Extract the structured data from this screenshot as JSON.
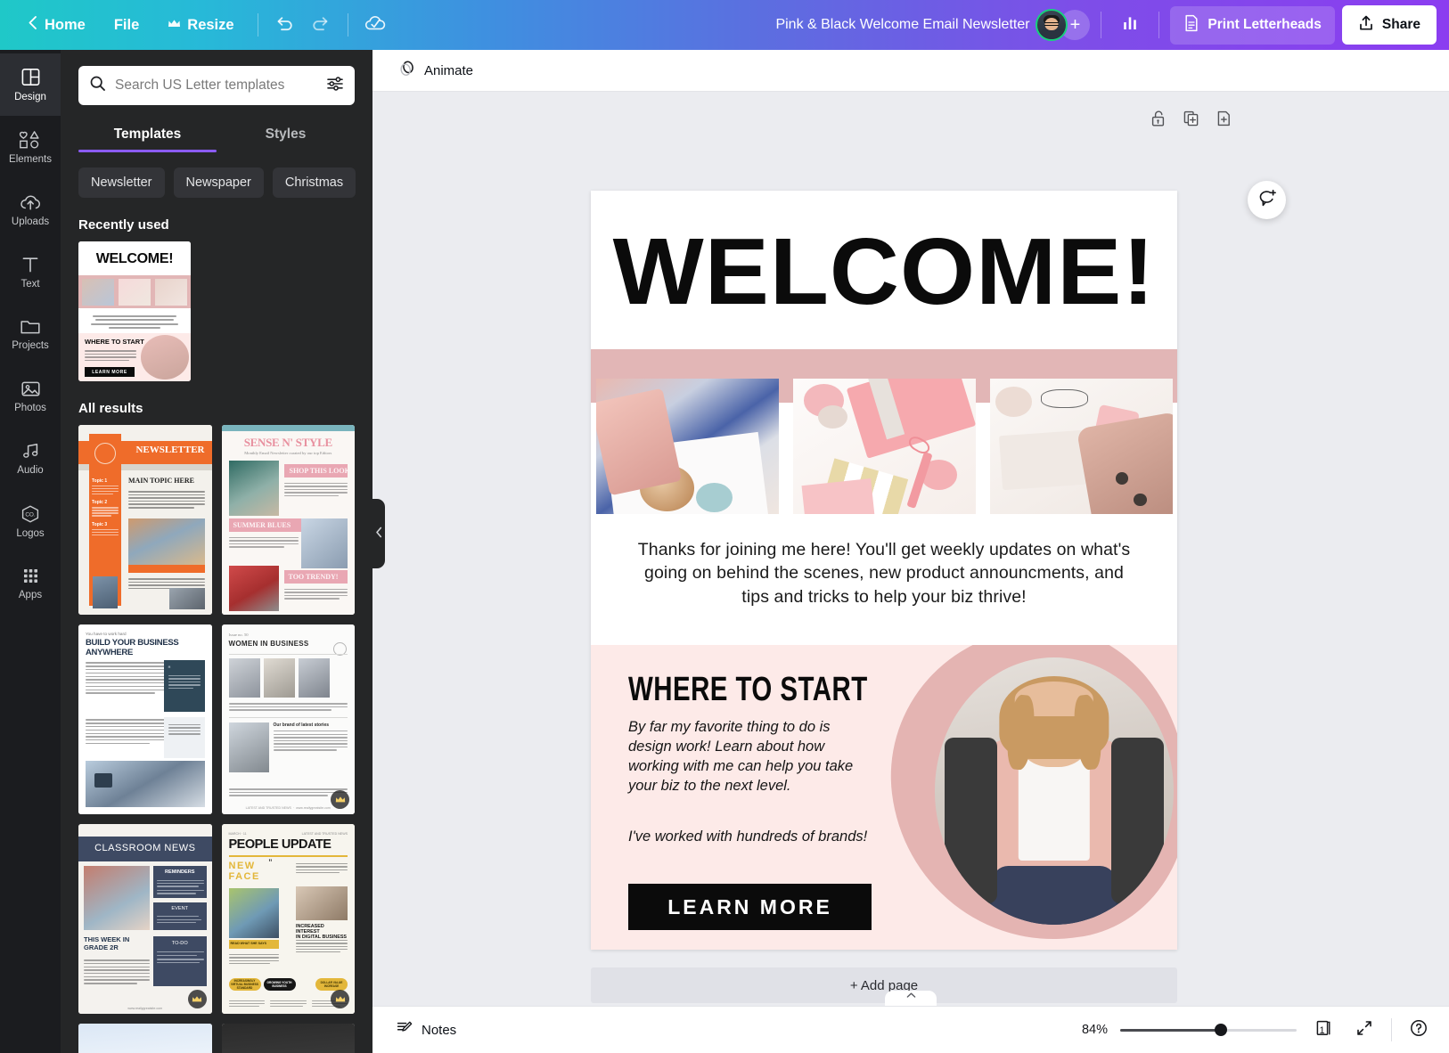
{
  "topbar": {
    "back_icon": "chevron-left-icon",
    "home_label": "Home",
    "file_label": "File",
    "resize_label": "Resize",
    "resize_icon": "crown-icon",
    "undo_icon": "undo-icon",
    "redo_icon": "redo-icon",
    "cloud_icon": "cloud-saved-icon",
    "doc_title": "Pink & Black Welcome Email Newsletter",
    "avatar_name": "avatar",
    "invite_label": "+",
    "insights_icon": "bar-chart-icon",
    "print_icon": "document-icon",
    "print_label": "Print Letterheads",
    "share_icon": "share-upload-icon",
    "share_label": "Share",
    "gradient_start": "#1fc8c8",
    "gradient_end": "#8b3df0"
  },
  "rail": {
    "items": [
      {
        "label": "Design",
        "icon": "layout-icon",
        "active": true
      },
      {
        "label": "Elements",
        "icon": "shapes-icon",
        "active": false
      },
      {
        "label": "Uploads",
        "icon": "cloud-up-icon",
        "active": false
      },
      {
        "label": "Text",
        "icon": "text-t-icon",
        "active": false
      },
      {
        "label": "Projects",
        "icon": "folder-icon",
        "active": false
      },
      {
        "label": "Photos",
        "icon": "photo-icon",
        "active": false
      },
      {
        "label": "Audio",
        "icon": "music-icon",
        "active": false
      },
      {
        "label": "Logos",
        "icon": "logo-hex-icon",
        "active": false
      },
      {
        "label": "Apps",
        "icon": "grid-dots-icon",
        "active": false
      }
    ]
  },
  "panel": {
    "search": {
      "placeholder": "Search US Letter templates",
      "value": "",
      "search_icon": "search-icon",
      "filter_icon": "filter-sliders-icon"
    },
    "tabs": [
      {
        "label": "Templates",
        "active": true
      },
      {
        "label": "Styles",
        "active": false
      }
    ],
    "chips": [
      "Newsletter",
      "Newspaper",
      "Christmas"
    ],
    "chip_next_icon": "chevron-right-icon",
    "recently_used_title": "Recently used",
    "recent_items": [
      {
        "name": "Pink & Black Welcome Email Newsletter",
        "title": "WELCOME!"
      }
    ],
    "all_results_title": "All results",
    "results": [
      {
        "title": "NEWSLETTER",
        "subtitle": "MAIN TOPIC HERE",
        "accent": "#ef6c2a",
        "pro": false
      },
      {
        "title": "SENSE N' STYLE",
        "subtitle": "SHOP THIS LOOK",
        "accent": "#e8a0a8",
        "pro": false
      },
      {
        "title": "BUILD YOUR BUSINESS ANYWHERE",
        "subtitle": "You have to work hard",
        "accent": "#2f4858",
        "pro": false
      },
      {
        "title": "WOMEN IN BUSINESS",
        "subtitle": "Issue no. 50",
        "accent": "#6b6b6b",
        "pro": true
      },
      {
        "title": "CLASSROOM NEWS",
        "subtitle": "THIS WEEK IN GRADE 2R",
        "accent": "#3e4a63",
        "pro": true
      },
      {
        "title": "PEOPLE UPDATE",
        "subtitle": "NEW FACE",
        "accent": "#e3b73a",
        "pro": true
      }
    ],
    "collapse_icon": "chevron-left-icon"
  },
  "main": {
    "animate_label": "Animate",
    "animate_icon": "animate-icon",
    "page_tools": [
      {
        "icon": "unlock-icon",
        "name": "lock-page-button"
      },
      {
        "icon": "duplicate-icon",
        "name": "duplicate-page-button"
      },
      {
        "icon": "add-page-icon",
        "name": "add-page-button"
      }
    ],
    "comment_icon": "add-comment-icon",
    "add_page_label": "+ Add page",
    "notes_tab_icon": "chevron-up-icon"
  },
  "design": {
    "heading": "WELCOME!",
    "band_color": "#e2b6b6",
    "photos": [
      {
        "name": "coffee-and-notebook-photo"
      },
      {
        "name": "pink-stationery-flatlay-photo"
      },
      {
        "name": "desk-essentials-photo"
      }
    ],
    "body_copy": "Thanks for joining me here! You'll get weekly updates on what's going on behind the scenes, new product announcments, and tips and tricks to help your biz thrive!",
    "section_heading": "WHERE TO START",
    "paragraph_1": "By far my favorite thing to do is design work! Learn about how working with me can help you take your biz to the next level.",
    "paragraph_2": "I've worked with hundreds of brands!",
    "cta_label": "LEARN MORE",
    "portrait_name": "woman-in-pink-cardigan-portrait",
    "lower_bg_color": "#fdeae8",
    "brush_color": "#e4b4b2"
  },
  "bottombar": {
    "notes_label": "Notes",
    "notes_icon": "notes-icon",
    "zoom_value": "84%",
    "zoom_percent": 84,
    "page_count": "1",
    "page_count_icon": "pages-icon",
    "fullscreen_icon": "expand-arrows-icon",
    "help_icon": "help-circle-icon"
  }
}
